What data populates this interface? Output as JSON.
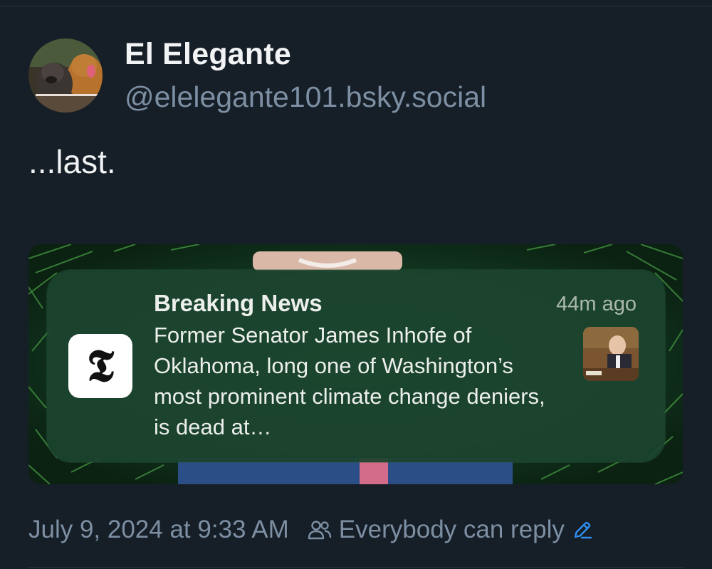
{
  "author": {
    "display_name": "El Elegante",
    "handle": "@elelegante101.bsky.social"
  },
  "post": {
    "text": "...last."
  },
  "embed": {
    "notification": {
      "title": "Breaking News",
      "time": "44m ago",
      "body": "Former Senator James Inhofe of Oklahoma, long one of Washington’s most prominent climate change deniers, is dead at…",
      "app_icon_glyph": "𝕿",
      "app_icon_name": "nyt-app-icon"
    }
  },
  "meta": {
    "timestamp": "July 9, 2024 at 9:33 AM",
    "reply_setting": "Everybody can reply"
  },
  "colors": {
    "background": "#161e27",
    "muted_text": "#7d8fa3",
    "accent": "#2f8ff0"
  }
}
